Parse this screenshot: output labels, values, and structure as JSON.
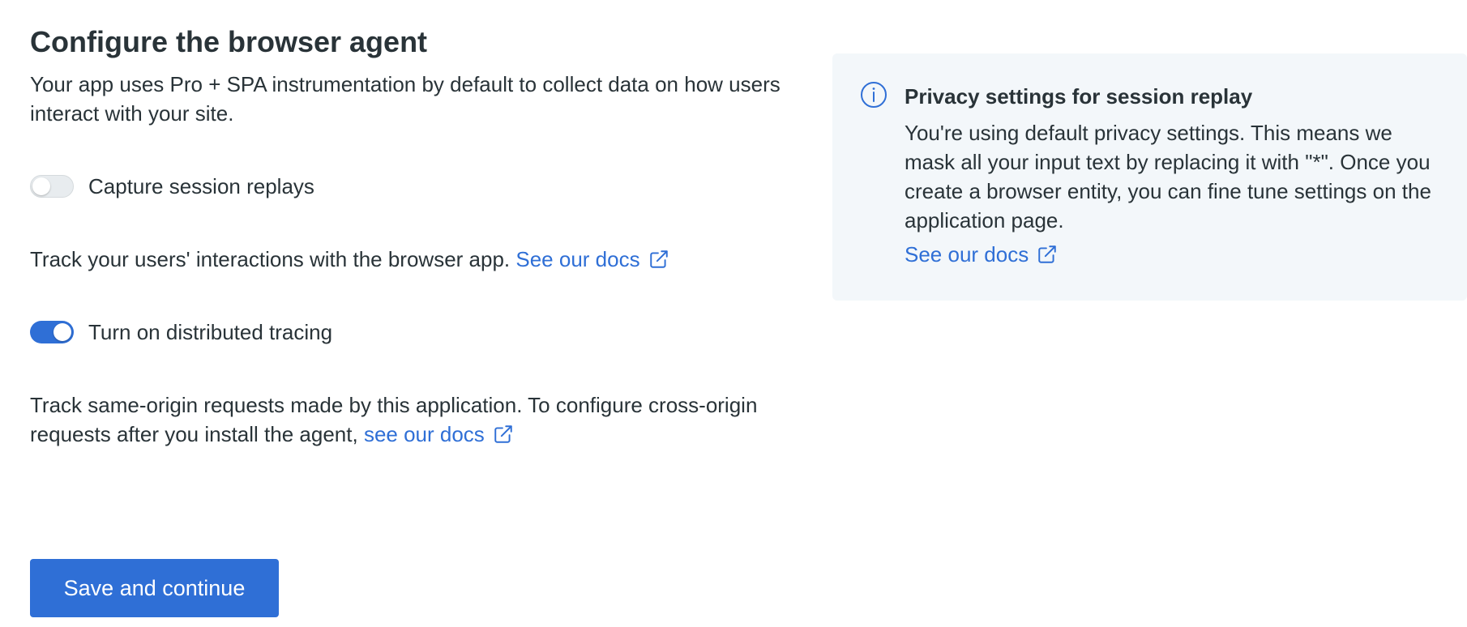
{
  "header": {
    "title": "Configure the browser agent"
  },
  "intro": "Your app uses Pro + SPA instrumentation by default to collect data on how users interact with your site.",
  "session_replay": {
    "toggle_label": "Capture session replays",
    "enabled": false,
    "description": "Track your users' interactions with the browser app.",
    "link_text": "See our docs"
  },
  "distributed_tracing": {
    "toggle_label": "Turn on distributed tracing",
    "enabled": true,
    "description": "Track same-origin requests made by this application. To configure cross-origin requests after you install the agent,",
    "link_text": "see our docs"
  },
  "actions": {
    "save_label": "Save and continue"
  },
  "privacy_panel": {
    "title": "Privacy settings for session replay",
    "body": "You're using default privacy settings. This means we mask all your input text by replacing it with \"*\". Once you create a browser entity, you can fine tune settings on the application page.",
    "link_text": "See our docs"
  },
  "colors": {
    "accent": "#2f6fd6",
    "text": "#293338",
    "panel_bg": "#f3f7fa"
  },
  "icons": [
    "external-link-icon",
    "info-icon"
  ]
}
